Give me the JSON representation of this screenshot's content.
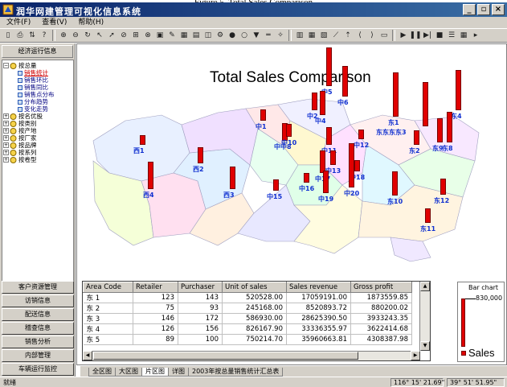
{
  "caption": "Figure 5. Total Sales Comparison",
  "window": {
    "title": "润华网建管理可视化信息系统",
    "min_label": "_",
    "restore_label": "▫",
    "close_label": "×"
  },
  "menu": [
    "文件(F)",
    "查看(V)",
    "帮助(H)"
  ],
  "sidebar": {
    "header": "经济运行信息",
    "tree": [
      {
        "label": "按总量",
        "level": 0,
        "expanded": true
      },
      {
        "label": "销售统计",
        "level": 1,
        "selected": true
      },
      {
        "label": "销售环比",
        "level": 1
      },
      {
        "label": "销售同比",
        "level": 1
      },
      {
        "label": "销售点分布",
        "level": 1
      },
      {
        "label": "分布趋势",
        "level": 1
      },
      {
        "label": "变化走势",
        "level": 1
      },
      {
        "label": "按名优股",
        "level": 0
      },
      {
        "label": "按类别",
        "level": 0
      },
      {
        "label": "按产地",
        "level": 0
      },
      {
        "label": "按厂家",
        "level": 0
      },
      {
        "label": "按品牌",
        "level": 0
      },
      {
        "label": "按系列",
        "level": 0
      },
      {
        "label": "按卷型",
        "level": 0
      }
    ],
    "nav": [
      "客户资源管理",
      "访销信息",
      "配送信息",
      "稽查信息",
      "销售分析",
      "内部管理",
      "车辆运行监控"
    ]
  },
  "map": {
    "title": "Total Sales Comparison",
    "labels": [
      {
        "text": "西1"
      },
      {
        "text": "西4"
      },
      {
        "text": "西2"
      },
      {
        "text": "西3"
      },
      {
        "text": "中1"
      },
      {
        "text": "中中8"
      },
      {
        "text": "中10"
      },
      {
        "text": "中2"
      },
      {
        "text": "中5"
      },
      {
        "text": "中4"
      },
      {
        "text": "中6"
      },
      {
        "text": "中11"
      },
      {
        "text": "中13"
      },
      {
        "text": "中12"
      },
      {
        "text": "中17"
      },
      {
        "text": "中18"
      },
      {
        "text": "中16"
      },
      {
        "text": "中15"
      },
      {
        "text": "中19"
      },
      {
        "text": "中20"
      },
      {
        "text": "东1"
      },
      {
        "text": "东2"
      },
      {
        "text": "东4"
      },
      {
        "text": "东东东东3"
      },
      {
        "text": "东9"
      },
      {
        "text": "东8"
      },
      {
        "text": "东10"
      },
      {
        "text": "东12"
      },
      {
        "text": "东11"
      }
    ]
  },
  "table": {
    "headers": [
      "Area Code",
      "Retailer",
      "Purchaser",
      "Unit of sales",
      "Sales revenue",
      "Gross profit"
    ],
    "rows": [
      [
        "东 1",
        "123",
        "143",
        "520528.00",
        "17059191.00",
        "1873559.85"
      ],
      [
        "东 2",
        "75",
        "93",
        "245168.00",
        "8520893.72",
        "880200.02"
      ],
      [
        "东 3",
        "146",
        "172",
        "586930.00",
        "28625390.50",
        "3933243.35"
      ],
      [
        "东 4",
        "126",
        "156",
        "826167.90",
        "33336355.97",
        "3622414.68"
      ],
      [
        "东 5",
        "89",
        "100",
        "750214.70",
        "35960663.81",
        "4308387.98"
      ]
    ]
  },
  "legend": {
    "title": "Bar chart",
    "value": "830,000",
    "series_name": "Sales"
  },
  "tabs": [
    "全区图",
    "大区图",
    "片区图",
    "详图",
    "2003年按总量销售统计汇总表"
  ],
  "active_tab": 2,
  "status": {
    "text": "就绪",
    "coord_x": "116° 15' 21.69\"",
    "coord_y": "39° 51' 51.95\""
  },
  "colors": {
    "bar": "#e00000",
    "label": "#1030d0",
    "titlebar": "#0a246a"
  }
}
